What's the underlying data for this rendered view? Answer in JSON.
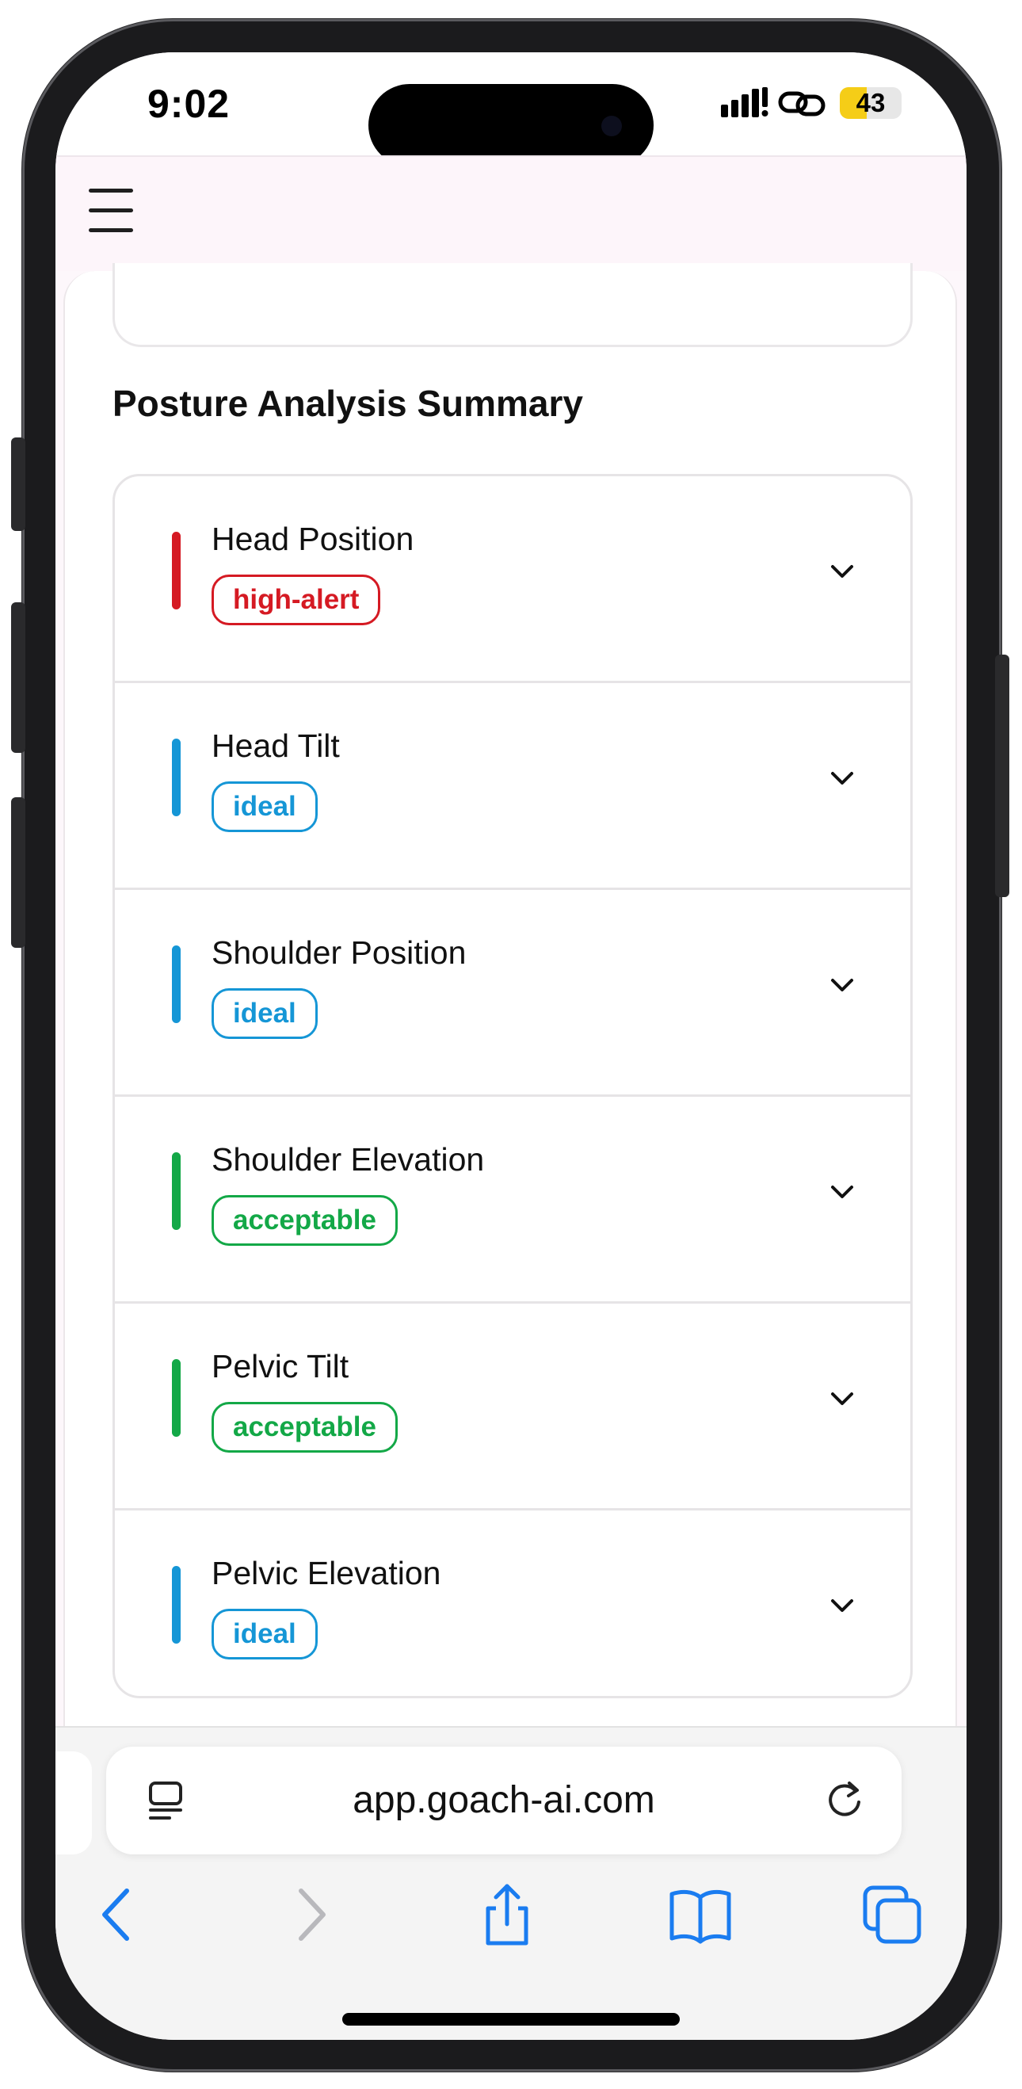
{
  "status_bar": {
    "time": "9:02",
    "battery_level": 43,
    "battery_label": "43",
    "icons": [
      "cellular-signal-icon",
      "link-icon",
      "battery-icon"
    ]
  },
  "header": {
    "menu_icon": "hamburger-menu-icon"
  },
  "content": {
    "section_title": "Posture Analysis Summary",
    "items": [
      {
        "label": "Head Position",
        "status": "high-alert",
        "color": "#d51a23"
      },
      {
        "label": "Head Tilt",
        "status": "ideal",
        "color": "#1596d6"
      },
      {
        "label": "Shoulder Position",
        "status": "ideal",
        "color": "#1596d6"
      },
      {
        "label": "Shoulder Elevation",
        "status": "acceptable",
        "color": "#13a847"
      },
      {
        "label": "Pelvic Tilt",
        "status": "acceptable",
        "color": "#13a847"
      },
      {
        "label": "Pelvic Elevation",
        "status": "ideal",
        "color": "#1596d6"
      }
    ]
  },
  "browser": {
    "url": "app.goach-ai.com",
    "accent_color": "#1a7cf0",
    "toolbar": [
      "back-icon",
      "forward-icon",
      "share-icon",
      "bookmarks-icon",
      "tabs-icon"
    ]
  }
}
